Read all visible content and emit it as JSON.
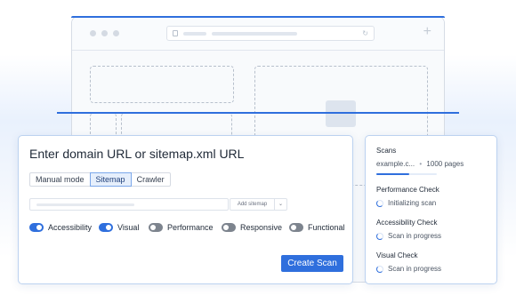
{
  "browser": {
    "window_dots": 3,
    "address_lock_icon": "lock-icon",
    "reload_icon": "reload-icon",
    "new_tab_icon": "plus-icon",
    "image_placeholder_icon": "image-icon"
  },
  "scan_form": {
    "title": "Enter domain URL or sitemap.xml URL",
    "modes": [
      {
        "label": "Manual mode",
        "active": false
      },
      {
        "label": "Sitemap",
        "active": true
      },
      {
        "label": "Crawler",
        "active": false
      }
    ],
    "url_input": {
      "value": "",
      "placeholder": ""
    },
    "add_sitemap_label": "Add sitemap",
    "add_sitemap_dropdown_icon": "chevron-down-icon",
    "checks": [
      {
        "label": "Accessibility",
        "enabled": true
      },
      {
        "label": "Visual",
        "enabled": true
      },
      {
        "label": "Performance",
        "enabled": false
      },
      {
        "label": "Responsive",
        "enabled": false
      },
      {
        "label": "Functional",
        "enabled": false
      }
    ],
    "create_button_label": "Create Scan"
  },
  "scans_panel": {
    "heading": "Scans",
    "domain": "example.c...",
    "separator": "•",
    "pages": "1000 pages",
    "progress_fraction": 0.55,
    "checks": [
      {
        "title": "Performance Check",
        "status": "Initializing scan"
      },
      {
        "title": "Accessibility Check",
        "status": "Scan in progress"
      },
      {
        "title": "Visual Check",
        "status": "Scan in progress"
      }
    ]
  },
  "colors": {
    "accent": "#2f6fdd",
    "toggle_off": "#7d848e",
    "border": "#bcd2f0"
  }
}
